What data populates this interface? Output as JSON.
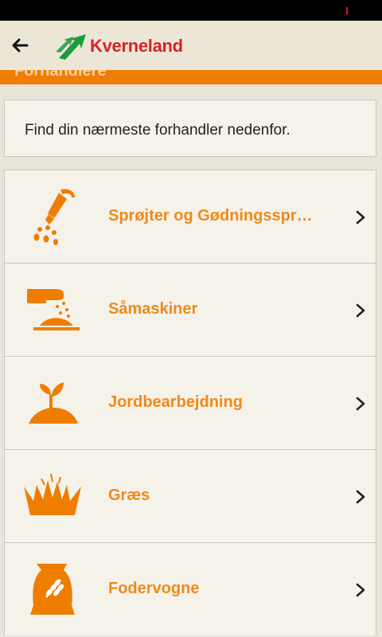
{
  "header": {
    "brand": "Kverneland",
    "back_icon": "arrow-left-icon",
    "band_title": "Forhandlere"
  },
  "colors": {
    "accent": "#ef7d00",
    "label": "#ef8a1a",
    "brand_red": "#d4242b",
    "brand_green": "#1a9b3c"
  },
  "info": {
    "text": "Find din nærmeste forhandler nedenfor."
  },
  "categories": [
    {
      "label": "Sprøjter og Gødningsspr…",
      "icon": "sprayer-icon"
    },
    {
      "label": "Såmaskiner",
      "icon": "seed-drill-icon"
    },
    {
      "label": "Jordbearbejdning",
      "icon": "sprout-soil-icon"
    },
    {
      "label": "Græs",
      "icon": "grass-icon"
    },
    {
      "label": "Fodervogne",
      "icon": "feed-bag-icon"
    }
  ]
}
